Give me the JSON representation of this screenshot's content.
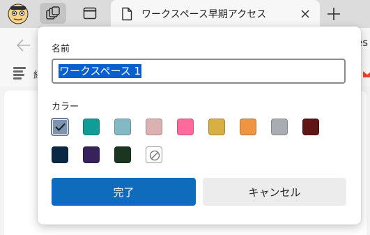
{
  "tab": {
    "title": "ワークスペース早期アクセス"
  },
  "toolbar": {
    "address_fragment": "es"
  },
  "favorites": {
    "first_label": "紹"
  },
  "dialog": {
    "name_label": "名前",
    "name_value": "ワークスペース 1",
    "color_label": "カラー",
    "colors": [
      {
        "name": "blue-gray",
        "hex": "#7e93ad",
        "selected": true
      },
      {
        "name": "teal",
        "hex": "#119c98",
        "selected": false
      },
      {
        "name": "light-teal",
        "hex": "#84b8c5",
        "selected": false
      },
      {
        "name": "rose",
        "hex": "#dcb1b1",
        "selected": false
      },
      {
        "name": "pink",
        "hex": "#ff6a9c",
        "selected": false
      },
      {
        "name": "gold",
        "hex": "#d8af44",
        "selected": false
      },
      {
        "name": "orange",
        "hex": "#ef9440",
        "selected": false
      },
      {
        "name": "gray",
        "hex": "#a9acb2",
        "selected": false
      },
      {
        "name": "maroon",
        "hex": "#5f1515",
        "selected": false
      },
      {
        "name": "navy",
        "hex": "#0b2746",
        "selected": false
      },
      {
        "name": "purple",
        "hex": "#37225e",
        "selected": false
      },
      {
        "name": "dark-green",
        "hex": "#1a3520",
        "selected": false
      },
      {
        "name": "no-color",
        "hex": "#ffffff",
        "selected": false
      }
    ],
    "done_label": "完了",
    "cancel_label": "キャンセル"
  }
}
